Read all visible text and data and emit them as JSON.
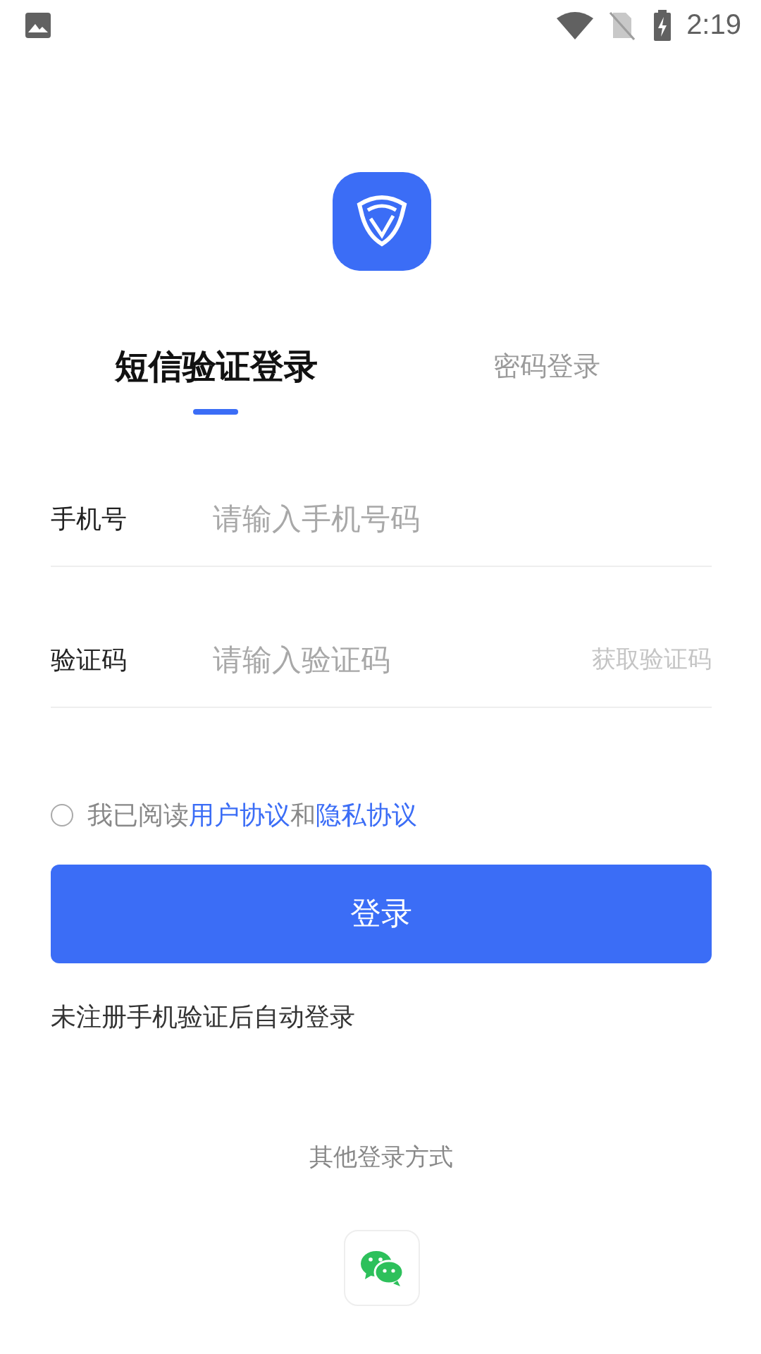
{
  "status_bar": {
    "time": "2:19"
  },
  "tabs": [
    {
      "label": "短信验证登录",
      "selected": true
    },
    {
      "label": "密码登录",
      "selected": false
    }
  ],
  "fields": [
    {
      "label": "手机号",
      "placeholder": "请输入手机号码"
    },
    {
      "label": "验证码",
      "placeholder": "请输入验证码",
      "action": "获取验证码"
    }
  ],
  "agreement": {
    "checked": false,
    "parts": [
      {
        "kind": "text",
        "text": "我已阅读"
      },
      {
        "kind": "link",
        "text": "用户协议"
      },
      {
        "kind": "text",
        "text": "和"
      },
      {
        "kind": "link",
        "text": "隐私协议"
      }
    ]
  },
  "login_button": "登录",
  "note": "未注册手机验证后自动登录",
  "other_login": {
    "title": "其他登录方式"
  }
}
